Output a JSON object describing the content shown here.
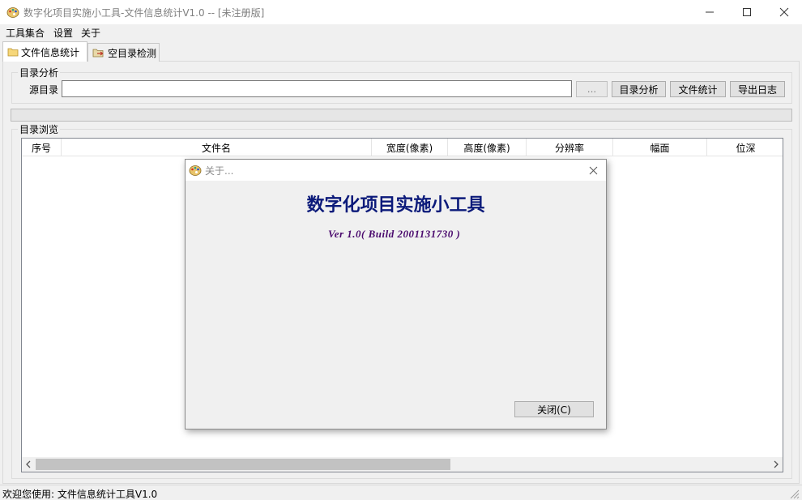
{
  "window": {
    "title": "数字化项目实施小工具-文件信息统计V1.0 -- [未注册版]",
    "icon": "palette-icon"
  },
  "menu": {
    "items": [
      "工具集合",
      "设置",
      "关于"
    ]
  },
  "tabs": [
    {
      "label": "文件信息统计",
      "icon": "folder-icon",
      "active": true
    },
    {
      "label": "空目录检测",
      "icon": "folder-arrow-icon",
      "active": false
    }
  ],
  "analysis": {
    "group_label": "目录分析",
    "source_label": "源目录",
    "source_value": "",
    "browse_button": "...",
    "analyze_button": "目录分析",
    "stats_button": "文件统计",
    "export_button": "导出日志"
  },
  "browse": {
    "group_label": "目录浏览",
    "columns": [
      "序号",
      "文件名",
      "宽度(像素)",
      "高度(像素)",
      "分辨率",
      "幅面",
      "位深"
    ],
    "rows": []
  },
  "status": {
    "text": "欢迎您使用: 文件信息统计工具V1.0"
  },
  "about_dialog": {
    "title": "关于...",
    "heading": "数字化项目实施小工具",
    "version": "Ver 1.0( Build 2001131730 )",
    "close_button": "关闭(C)"
  },
  "colors": {
    "heading": "#0b1a7a",
    "version": "#4b0b6e"
  }
}
